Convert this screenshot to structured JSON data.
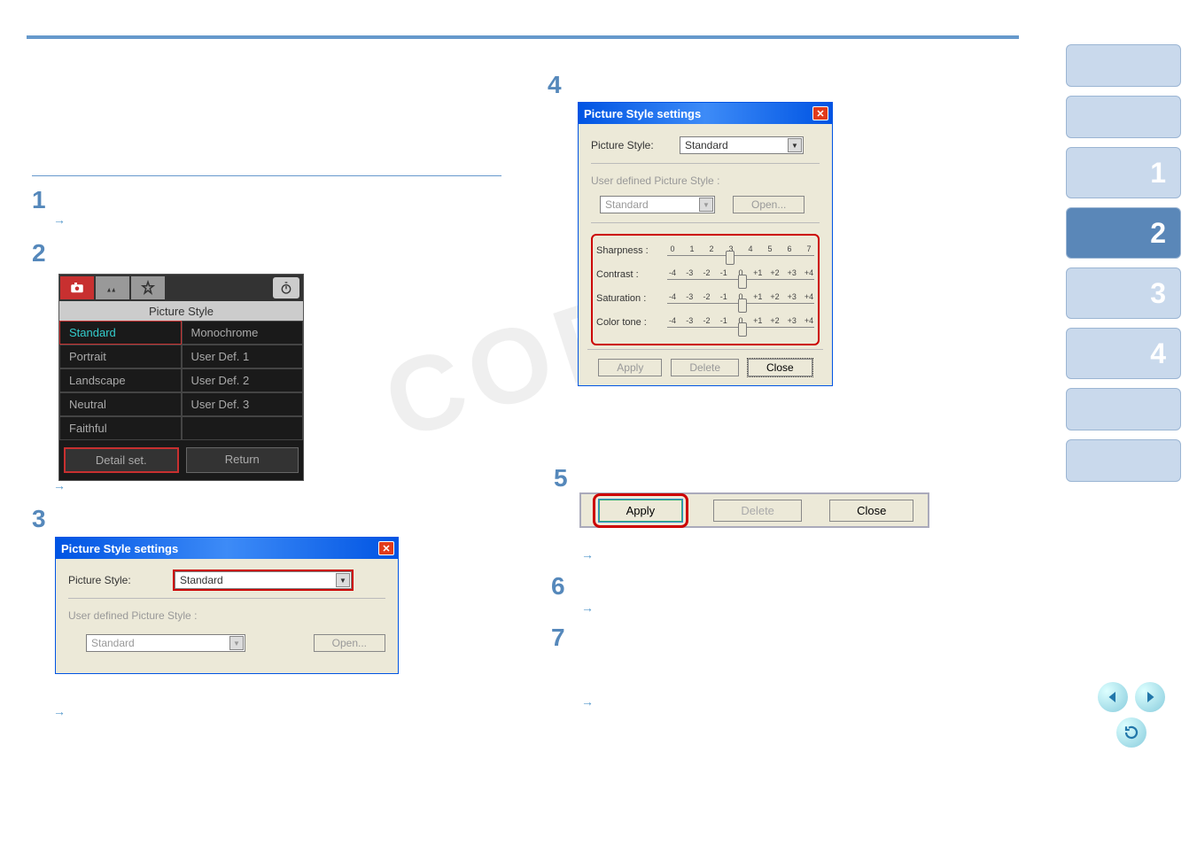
{
  "watermark": "COPY",
  "steps": [
    "1",
    "2",
    "3",
    "4",
    "5",
    "6",
    "7"
  ],
  "camera_menu": {
    "title": "Picture Style",
    "items": [
      {
        "col1": "Standard",
        "col2": "Monochrome",
        "selected": true
      },
      {
        "col1": "Portrait",
        "col2": "User Def. 1"
      },
      {
        "col1": "Landscape",
        "col2": "User Def. 2"
      },
      {
        "col1": "Neutral",
        "col2": "User Def. 3"
      },
      {
        "col1": "Faithful",
        "col2": ""
      }
    ],
    "detail_btn": "Detail set.",
    "return_btn": "Return"
  },
  "dialog3": {
    "title": "Picture Style settings",
    "style_label": "Picture Style:",
    "style_value": "Standard",
    "udef_label": "User defined Picture Style :",
    "udef_value": "Standard",
    "open_btn": "Open..."
  },
  "dialog4": {
    "title": "Picture Style settings",
    "style_label": "Picture Style:",
    "style_value": "Standard",
    "udef_label": "User defined Picture Style :",
    "udef_value": "Standard",
    "open_btn": "Open...",
    "sharp_label": "Sharpness :",
    "contrast_label": "Contrast :",
    "sat_label": "Saturation :",
    "tone_label": "Color tone :",
    "sharp_ticks": [
      "0",
      "1",
      "2",
      "3",
      "4",
      "5",
      "6",
      "7"
    ],
    "signed_ticks": [
      "-4",
      "-3",
      "-2",
      "-1",
      "0",
      "+1",
      "+2",
      "+3",
      "+4"
    ],
    "apply_btn": "Apply",
    "delete_btn": "Delete",
    "close_btn": "Close"
  },
  "apply_bar": {
    "apply": "Apply",
    "delete": "Delete",
    "close": "Close"
  },
  "nav": {
    "items": [
      "",
      "",
      "1",
      "2",
      "3",
      "4",
      "",
      ""
    ],
    "active_index": 3
  }
}
